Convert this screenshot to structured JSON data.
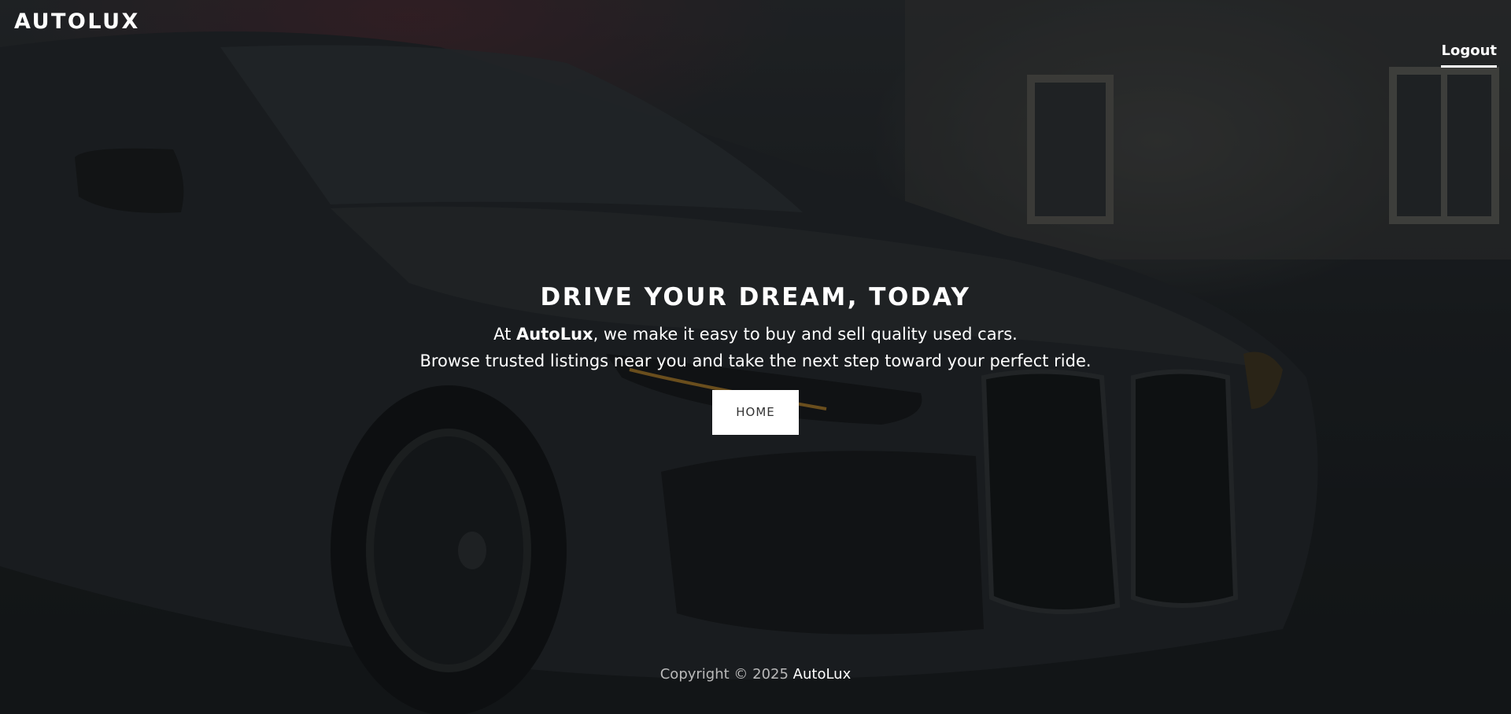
{
  "header": {
    "brand": "AUTOLUX",
    "logout_label": "Logout"
  },
  "hero": {
    "headline": "DRIVE YOUR DREAM, TODAY",
    "tagline_prefix": "At ",
    "tagline_brand": "AutoLux",
    "tagline_suffix": ", we make it easy to buy and sell quality used cars.",
    "tagline_line2": "Browse trusted listings near you and take the next step toward your perfect ride.",
    "button_label": "HOME",
    "background_image": "dark-sports-car-photo"
  },
  "footer": {
    "copyright_prefix": "Copyright © 2025 ",
    "copyright_brand": "AutoLux"
  },
  "colors": {
    "text": "#ffffff",
    "button_bg": "#ffffff",
    "button_text": "#333333",
    "footer_text": "#b9b9b9"
  }
}
